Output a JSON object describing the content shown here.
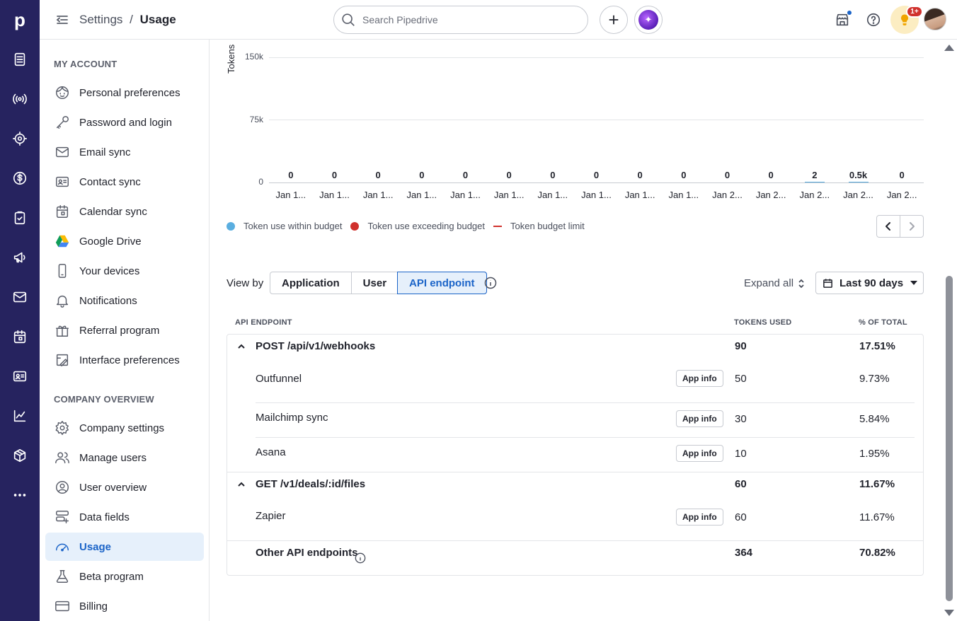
{
  "topbar": {
    "breadcrumb_parent": "Settings",
    "breadcrumb_sep": "/",
    "breadcrumb_current": "Usage",
    "search_placeholder": "Search Pipedrive",
    "badge": "1+"
  },
  "rail": {
    "logo": "p",
    "icons": [
      "deals-icon",
      "leads-icon",
      "focus-icon",
      "dollar-icon",
      "activities-icon",
      "campaigns-icon",
      "mail-icon",
      "calendar-icon",
      "contacts-icon",
      "insights-icon",
      "products-icon",
      "more-icon"
    ]
  },
  "sidebar": {
    "my_account_title": "MY ACCOUNT",
    "my_account": [
      {
        "label": "Personal preferences",
        "icon": "face-icon"
      },
      {
        "label": "Password and login",
        "icon": "key-icon"
      },
      {
        "label": "Email sync",
        "icon": "mail-icon"
      },
      {
        "label": "Contact sync",
        "icon": "contact-card-icon"
      },
      {
        "label": "Calendar sync",
        "icon": "calendar-icon"
      },
      {
        "label": "Google Drive",
        "icon": "google-drive-icon"
      },
      {
        "label": "Your devices",
        "icon": "phone-icon"
      },
      {
        "label": "Notifications",
        "icon": "bell-icon"
      },
      {
        "label": "Referral program",
        "icon": "gift-icon"
      },
      {
        "label": "Interface preferences",
        "icon": "interface-icon"
      }
    ],
    "company_title": "COMPANY OVERVIEW",
    "company": [
      {
        "label": "Company settings",
        "icon": "gear-icon"
      },
      {
        "label": "Manage users",
        "icon": "users-icon"
      },
      {
        "label": "User overview",
        "icon": "user-circle-icon"
      },
      {
        "label": "Data fields",
        "icon": "data-fields-icon"
      },
      {
        "label": "Usage",
        "icon": "gauge-icon"
      },
      {
        "label": "Beta program",
        "icon": "flask-icon"
      },
      {
        "label": "Billing",
        "icon": "card-icon"
      }
    ]
  },
  "chart_data": {
    "type": "bar",
    "ylabel": "Tokens",
    "yticks": [
      "150k",
      "75k",
      "0"
    ],
    "ylim": [
      0,
      150000
    ],
    "categories": [
      "Jan 1...",
      "Jan 1...",
      "Jan 1...",
      "Jan 1...",
      "Jan 1...",
      "Jan 1...",
      "Jan 1...",
      "Jan 1...",
      "Jan 1...",
      "Jan 1...",
      "Jan 2...",
      "Jan 2...",
      "Jan 2...",
      "Jan 2...",
      "Jan 2..."
    ],
    "data_labels": [
      "0",
      "0",
      "0",
      "0",
      "0",
      "0",
      "0",
      "0",
      "0",
      "0",
      "0",
      "0",
      "2",
      "0.5k",
      "0"
    ],
    "values": [
      0,
      0,
      0,
      0,
      0,
      0,
      0,
      0,
      0,
      0,
      0,
      0,
      2,
      500,
      0
    ],
    "legend": [
      {
        "label": "Token use within budget",
        "color": "#5aaee0",
        "kind": "dot"
      },
      {
        "label": "Token use exceeding budget",
        "color": "#d0312d",
        "kind": "dot"
      },
      {
        "label": "Token budget limit",
        "color": "#d0312d",
        "kind": "line"
      }
    ]
  },
  "controls": {
    "view_by": "View by",
    "tabs": [
      "Application",
      "User",
      "API endpoint"
    ],
    "active_tab": "API endpoint",
    "expand_all": "Expand all",
    "range": "Last 90 days"
  },
  "table": {
    "headers": [
      "API ENDPOINT",
      "TOKENS USED",
      "% OF TOTAL"
    ],
    "app_info": "App info",
    "groups": [
      {
        "name": "POST /api/v1/webhooks",
        "tokens": "90",
        "pct": "17.51%",
        "rows": [
          {
            "name": "Outfunnel",
            "tokens": "50",
            "pct": "9.73%"
          },
          {
            "name": "Mailchimp sync",
            "tokens": "30",
            "pct": "5.84%"
          },
          {
            "name": "Asana",
            "tokens": "10",
            "pct": "1.95%"
          }
        ]
      },
      {
        "name": "GET /v1/deals/:id/files",
        "tokens": "60",
        "pct": "11.67%",
        "rows": [
          {
            "name": "Zapier",
            "tokens": "60",
            "pct": "11.67%"
          }
        ]
      }
    ],
    "other": {
      "name": "Other API endpoints",
      "tokens": "364",
      "pct": "70.82%"
    }
  }
}
